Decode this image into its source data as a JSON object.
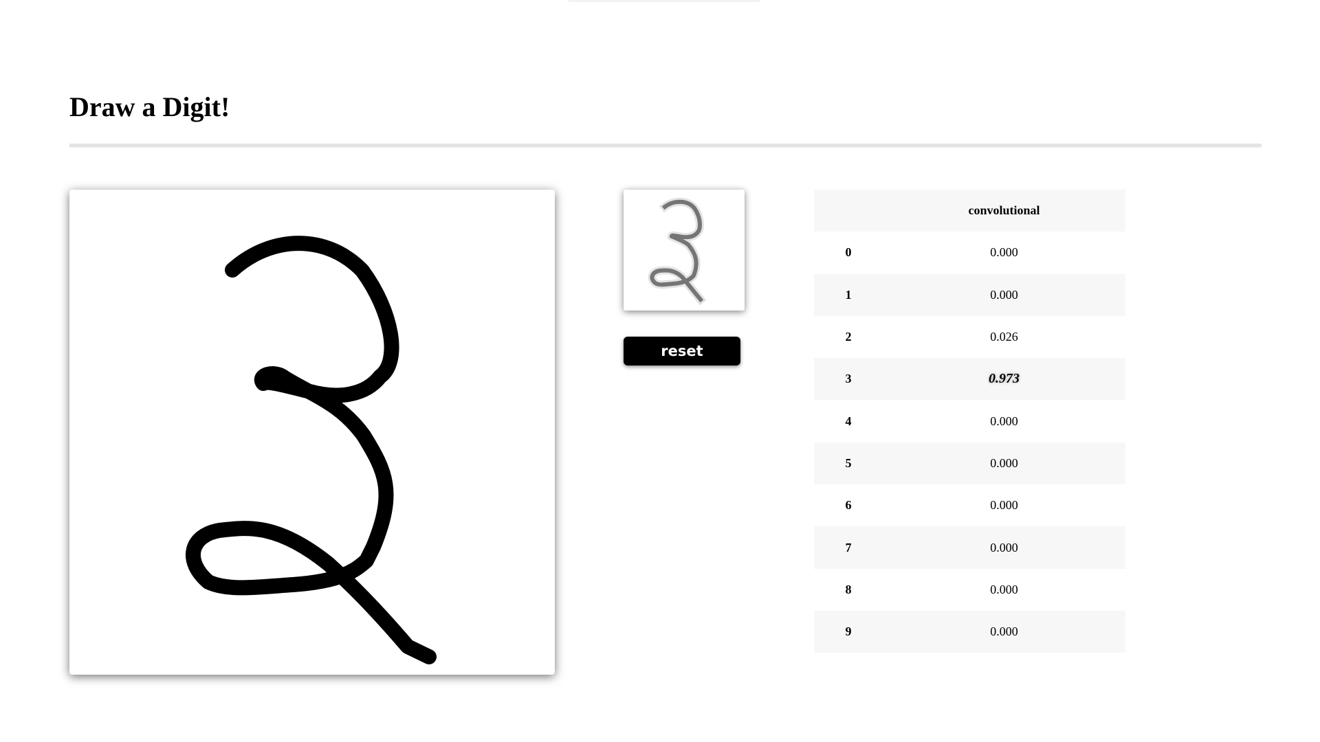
{
  "header": {
    "title": "Draw a Digit!"
  },
  "controls": {
    "reset_label": "reset"
  },
  "results": {
    "column_header": "convolutional",
    "rows": [
      {
        "label": "0",
        "value": "0.000"
      },
      {
        "label": "1",
        "value": "0.000"
      },
      {
        "label": "2",
        "value": "0.026"
      },
      {
        "label": "3",
        "value": "0.973",
        "highlight": true
      },
      {
        "label": "4",
        "value": "0.000"
      },
      {
        "label": "5",
        "value": "0.000"
      },
      {
        "label": "6",
        "value": "0.000"
      },
      {
        "label": "7",
        "value": "0.000"
      },
      {
        "label": "8",
        "value": "0.000"
      },
      {
        "label": "9",
        "value": "0.000"
      }
    ]
  },
  "colors": {
    "stroke": "#000000",
    "row_stripe": "#f7f7f7",
    "button_bg": "#000000",
    "button_text": "#ffffff"
  }
}
